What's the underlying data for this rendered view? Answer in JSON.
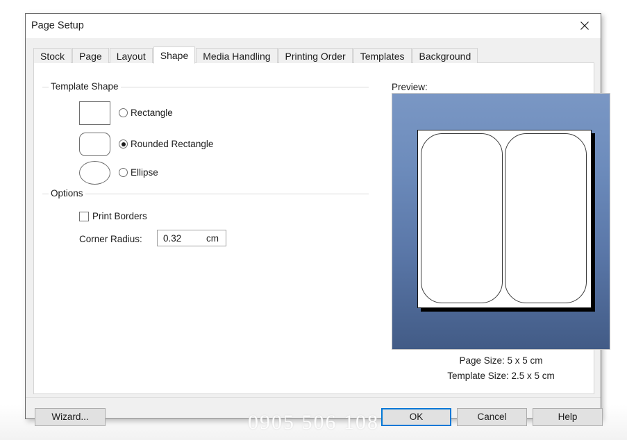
{
  "window": {
    "title": "Page Setup",
    "close_icon": "close-icon"
  },
  "tabs": [
    {
      "label": "Stock",
      "active": false
    },
    {
      "label": "Page",
      "active": false
    },
    {
      "label": "Layout",
      "active": false
    },
    {
      "label": "Shape",
      "active": true
    },
    {
      "label": "Media Handling",
      "active": false
    },
    {
      "label": "Printing Order",
      "active": false
    },
    {
      "label": "Templates",
      "active": false
    },
    {
      "label": "Background",
      "active": false
    }
  ],
  "template_shape": {
    "group_title": "Template Shape",
    "options": [
      {
        "label": "Rectangle",
        "selected": false,
        "swatch": "rectangle-swatch"
      },
      {
        "label": "Rounded Rectangle",
        "selected": true,
        "swatch": "rounded-rectangle-swatch"
      },
      {
        "label": "Ellipse",
        "selected": false,
        "swatch": "ellipse-swatch"
      }
    ]
  },
  "options": {
    "group_title": "Options",
    "print_borders": {
      "label": "Print Borders",
      "checked": false
    },
    "corner_radius": {
      "label": "Corner Radius:",
      "value": "0.32",
      "unit": "cm"
    }
  },
  "preview": {
    "label": "Preview:",
    "page_size": "Page Size:  5 x 5 cm",
    "template_size": "Template Size:  2.5 x 5 cm",
    "gradient_top": "#7a97c4",
    "gradient_bottom": "#425b86"
  },
  "footer": {
    "wizard": "Wizard...",
    "ok": "OK",
    "cancel": "Cancel",
    "help": "Help",
    "default_button_accent": "#0078d7"
  },
  "watermark": {
    "text": "0905 506 108"
  }
}
